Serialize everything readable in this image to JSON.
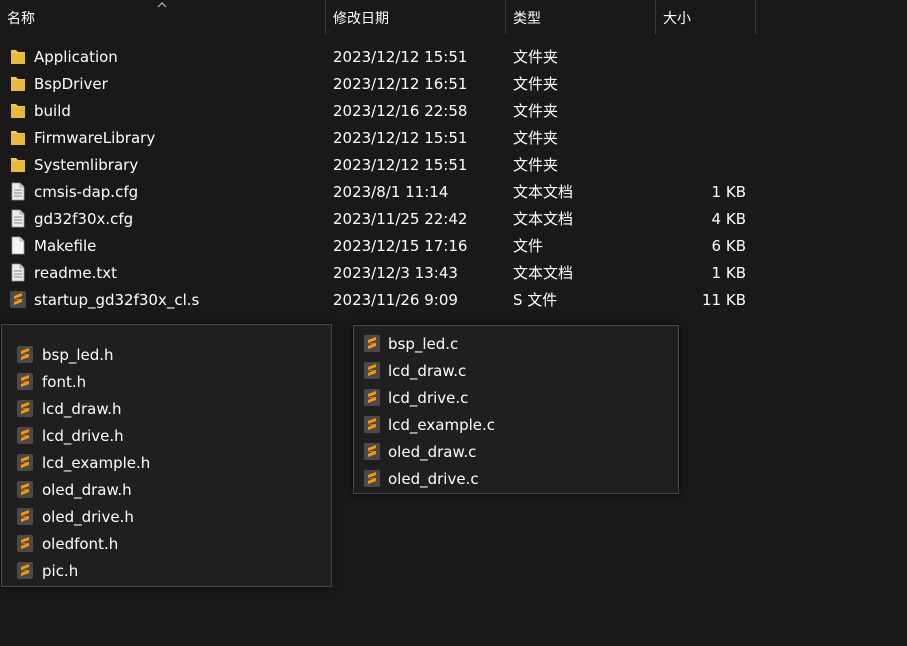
{
  "columns": [
    {
      "label": "名称",
      "sort": "ascending"
    },
    {
      "label": "修改日期"
    },
    {
      "label": "类型"
    },
    {
      "label": "大小"
    }
  ],
  "files": [
    {
      "icon": "folder-icon",
      "name": "Application",
      "date": "2023/12/12 15:51",
      "type": "文件夹",
      "size": ""
    },
    {
      "icon": "folder-icon",
      "name": "BspDriver",
      "date": "2023/12/12 16:51",
      "type": "文件夹",
      "size": ""
    },
    {
      "icon": "folder-icon",
      "name": "build",
      "date": "2023/12/16 22:58",
      "type": "文件夹",
      "size": ""
    },
    {
      "icon": "folder-icon",
      "name": "FirmwareLibrary",
      "date": "2023/12/12 15:51",
      "type": "文件夹",
      "size": ""
    },
    {
      "icon": "folder-icon",
      "name": "Systemlibrary",
      "date": "2023/12/12 15:51",
      "type": "文件夹",
      "size": ""
    },
    {
      "icon": "text-file-icon",
      "name": "cmsis-dap.cfg",
      "date": "2023/8/1 11:14",
      "type": "文本文档",
      "size": "1 KB"
    },
    {
      "icon": "text-file-icon",
      "name": "gd32f30x.cfg",
      "date": "2023/11/25 22:42",
      "type": "文本文档",
      "size": "4 KB"
    },
    {
      "icon": "blank-file-icon",
      "name": "Makefile",
      "date": "2023/12/15 17:16",
      "type": "文件",
      "size": "6 KB"
    },
    {
      "icon": "text-file-icon",
      "name": "readme.txt",
      "date": "2023/12/3 13:43",
      "type": "文本文档",
      "size": "1 KB"
    },
    {
      "icon": "sublime-file-icon",
      "name": "startup_gd32f30x_cl.s",
      "date": "2023/11/26 9:09",
      "type": "S 文件",
      "size": "11 KB"
    }
  ],
  "popup_headers": {
    "items": [
      "bsp_led.h",
      "font.h",
      "lcd_draw.h",
      "lcd_drive.h",
      "lcd_example.h",
      "oled_draw.h",
      "oled_drive.h",
      "oledfont.h",
      "pic.h"
    ]
  },
  "popup_sources": {
    "items": [
      "bsp_led.c",
      "lcd_draw.c",
      "lcd_drive.c",
      "lcd_example.c",
      "oled_draw.c",
      "oled_drive.c"
    ]
  },
  "colors": {
    "background": "#191919",
    "folder": "#f2c94c",
    "sublime_icon_bg": "#4a4a4a",
    "sublime_icon_fg": "#ff9800"
  }
}
